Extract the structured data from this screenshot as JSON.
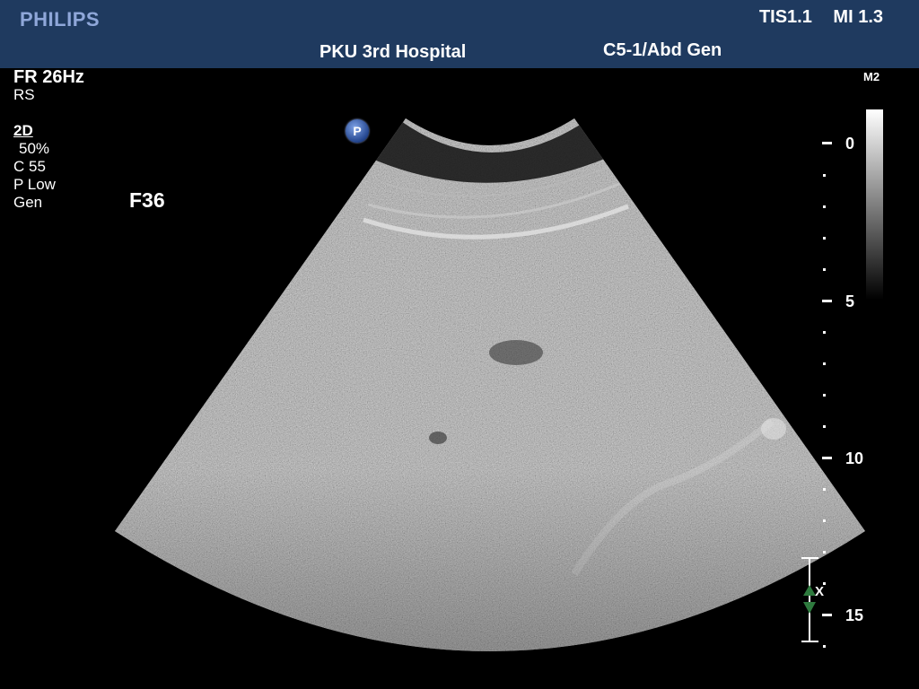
{
  "header": {
    "brand": "PHILIPS",
    "tis": "TIS1.1",
    "mi": "MI 1.3",
    "hospital": "PKU  3rd Hospital",
    "probe_preset": "C5-1/Abd Gen"
  },
  "params": {
    "frame_rate": "FR 26Hz",
    "res": "RS",
    "mode": "2D",
    "gain": "50%",
    "compression": "C 55",
    "persistence": "P Low",
    "preset": "Gen"
  },
  "focus_label": "F36",
  "grayscale_map": "M2",
  "p_badge": "P",
  "depth_scale": {
    "labels": [
      "0",
      "5",
      "10",
      "15"
    ]
  },
  "focus_marker": {
    "label": "X",
    "color": "#2e7a3e"
  },
  "colors": {
    "header_bg": "#1f3a5f",
    "brand": "#8fa7d9"
  }
}
